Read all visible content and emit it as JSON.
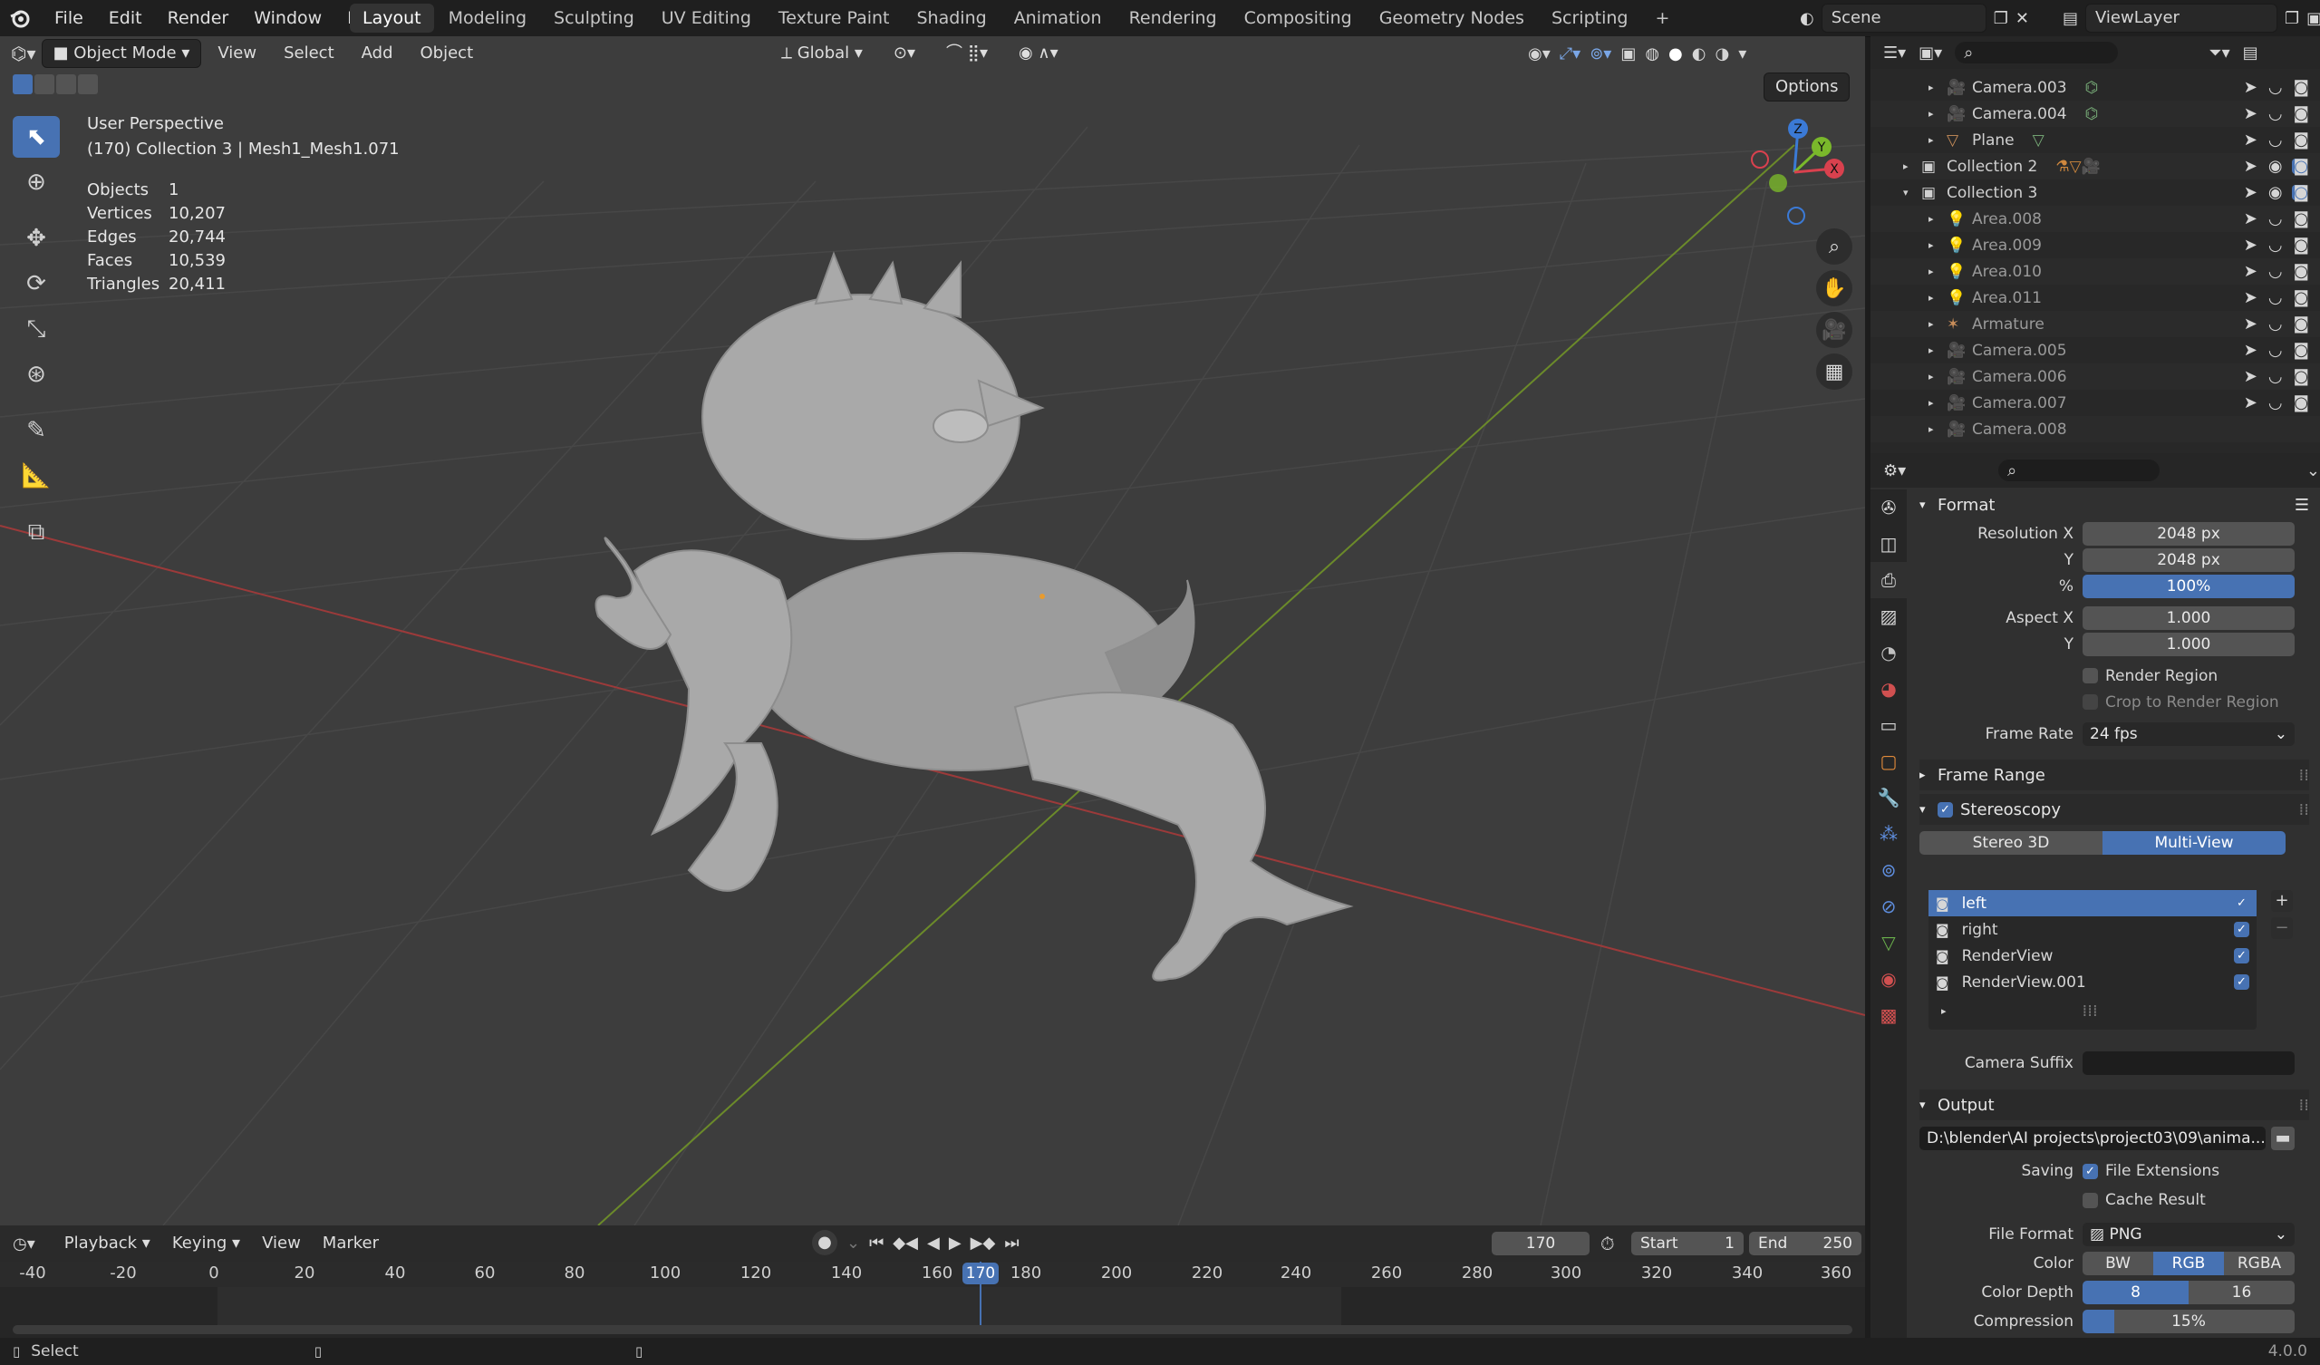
{
  "menu": [
    "File",
    "Edit",
    "Render",
    "Window",
    "Help"
  ],
  "workspaces": [
    "Layout",
    "Modeling",
    "Sculpting",
    "UV Editing",
    "Texture Paint",
    "Shading",
    "Animation",
    "Rendering",
    "Compositing",
    "Geometry Nodes",
    "Scripting"
  ],
  "active_workspace": "Layout",
  "scene": "Scene",
  "view_layer": "ViewLayer",
  "viewport": {
    "mode": "Object Mode",
    "menus": [
      "View",
      "Select",
      "Add",
      "Object"
    ],
    "orientation": "Global",
    "options": "Options",
    "title": "User Perspective",
    "subtitle": "(170) Collection 3 | Mesh1_Mesh1.071",
    "stats": [
      {
        "label": "Objects",
        "value": "1"
      },
      {
        "label": "Vertices",
        "value": "10,207"
      },
      {
        "label": "Edges",
        "value": "20,744"
      },
      {
        "label": "Faces",
        "value": "10,539"
      },
      {
        "label": "Triangles",
        "value": "20,411"
      }
    ],
    "gizmo": {
      "z": "Z",
      "y": "Y",
      "x": "X"
    }
  },
  "outliner": {
    "rows": [
      {
        "name": "Camera.003",
        "type": "camera",
        "indent": 2
      },
      {
        "name": "Camera.004",
        "type": "camera",
        "indent": 2
      },
      {
        "name": "Plane",
        "type": "mesh",
        "indent": 2
      },
      {
        "name": "Collection 2",
        "type": "collection",
        "indent": 1
      },
      {
        "name": "Collection 3",
        "type": "collection",
        "indent": 1
      },
      {
        "name": "Area.008",
        "type": "light",
        "indent": 2
      },
      {
        "name": "Area.009",
        "type": "light",
        "indent": 2
      },
      {
        "name": "Area.010",
        "type": "light",
        "indent": 2
      },
      {
        "name": "Area.011",
        "type": "light",
        "indent": 2
      },
      {
        "name": "Armature",
        "type": "armature",
        "indent": 2
      },
      {
        "name": "Camera.005",
        "type": "camera",
        "indent": 2
      },
      {
        "name": "Camera.006",
        "type": "camera",
        "indent": 2
      },
      {
        "name": "Camera.007",
        "type": "camera",
        "indent": 2
      },
      {
        "name": "Camera.008",
        "type": "camera",
        "indent": 2
      }
    ]
  },
  "properties": {
    "format": {
      "title": "Format",
      "res_x_label": "Resolution X",
      "res_x": "2048 px",
      "res_y_label": "Y",
      "res_y": "2048 px",
      "pct_label": "%",
      "pct": "100%",
      "aspect_x_label": "Aspect X",
      "aspect_x": "1.000",
      "aspect_y_label": "Y",
      "aspect_y": "1.000",
      "render_region": "Render Region",
      "crop": "Crop to Render Region",
      "frame_rate_label": "Frame Rate",
      "frame_rate": "24 fps"
    },
    "frame_range": "Frame Range",
    "stereoscopy": {
      "title": "Stereoscopy",
      "mode_a": "Stereo 3D",
      "mode_b": "Multi-View",
      "views": [
        "left",
        "right",
        "RenderView",
        "RenderView.001"
      ],
      "camera_suffix_label": "Camera Suffix"
    },
    "output": {
      "title": "Output",
      "path": "D:\\blender\\AI projects\\project03\\09\\anima...",
      "saving_label": "Saving",
      "file_ext": "File Extensions",
      "cache": "Cache Result",
      "format_label": "File Format",
      "format": "PNG",
      "color_label": "Color",
      "color_opts": [
        "BW",
        "RGB",
        "RGBA"
      ],
      "depth_label": "Color Depth",
      "depth_opts": [
        "8",
        "16"
      ],
      "compression_label": "Compression",
      "compression": "15%"
    }
  },
  "timeline": {
    "menus": [
      "Playback",
      "Keying",
      "View",
      "Marker"
    ],
    "current_frame": "170",
    "start_label": "Start",
    "start": "1",
    "end_label": "End",
    "end": "250",
    "ticks": [
      "-40",
      "-20",
      "0",
      "20",
      "40",
      "60",
      "80",
      "100",
      "120",
      "140",
      "160",
      "180",
      "200",
      "220",
      "240",
      "260",
      "280",
      "300",
      "320",
      "340",
      "360"
    ]
  },
  "status": {
    "left": "Select",
    "version": "4.0.0"
  }
}
